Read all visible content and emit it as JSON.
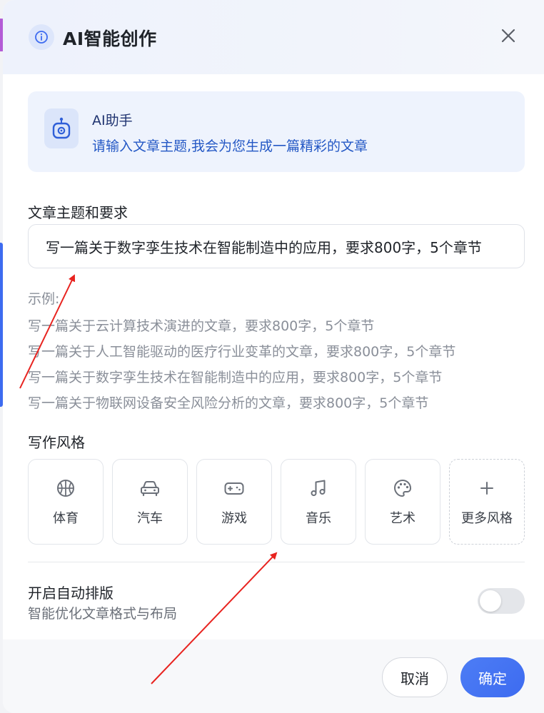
{
  "dialog": {
    "title": "AI智能创作"
  },
  "assistant": {
    "name": "AI助手",
    "description": "请输入文章主题,我会为您生成一篇精彩的文章"
  },
  "topic": {
    "label": "文章主题和要求",
    "value": "写一篇关于数字孪生技术在智能制造中的应用，要求800字，5个章节"
  },
  "examples": {
    "title": "示例:",
    "items": [
      "写一篇关于云计算技术演进的文章，要求800字，5个章节",
      "写一篇关于人工智能驱动的医疗行业变革的文章，要求800字，5个章节",
      "写一篇关于数字孪生技术在智能制造中的应用，要求800字，5个章节",
      "写一篇关于物联网设备安全风险分析的文章，要求800字，5个章节"
    ]
  },
  "styles": {
    "label": "写作风格",
    "items": [
      {
        "label": "体育",
        "icon": "basketball-icon"
      },
      {
        "label": "汽车",
        "icon": "car-icon"
      },
      {
        "label": "游戏",
        "icon": "gamepad-icon"
      },
      {
        "label": "音乐",
        "icon": "music-note-icon"
      },
      {
        "label": "艺术",
        "icon": "palette-icon"
      },
      {
        "label": "更多风格",
        "icon": "plus-icon"
      }
    ]
  },
  "auto_layout": {
    "title": "开启自动排版",
    "description": "智能优化文章格式与布局",
    "enabled": false
  },
  "footer": {
    "cancel_label": "取消",
    "confirm_label": "确定"
  },
  "colors": {
    "accent": "#3d6bf0",
    "assistant_text": "#2458c5",
    "annotation_arrow": "#e8231f"
  }
}
